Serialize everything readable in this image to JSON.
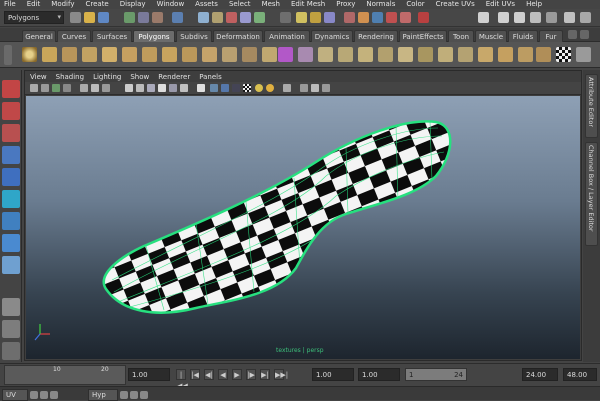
{
  "menubar": {
    "items": [
      "File",
      "Edit",
      "Modify",
      "Create",
      "Display",
      "Window",
      "Assets",
      "Select",
      "Mesh",
      "Edit Mesh",
      "Proxy",
      "Normals",
      "Color",
      "Create UVs",
      "Edit UVs",
      "Help"
    ]
  },
  "statusline": {
    "mode": "Polygons",
    "mode_arrow": "▾"
  },
  "shelf": {
    "tabs": [
      "General",
      "Curves",
      "Surfaces",
      "Polygons",
      "Subdivs",
      "Deformation",
      "Animation",
      "Dynamics",
      "Rendering",
      "PaintEffects",
      "Toon",
      "Muscle",
      "Fluids",
      "Fur"
    ],
    "active_tab": "Polygons"
  },
  "panel": {
    "menu": [
      "View",
      "Shading",
      "Lighting",
      "Show",
      "Renderer",
      "Panels"
    ],
    "camera_label": "textures | persp"
  },
  "side_tabs": {
    "attribute_editor": "Attribute Editor",
    "channel_box": "Channel Box / Layer Editor"
  },
  "timeslider": {
    "ticks": [
      "10",
      "20"
    ],
    "current_time": "1.00",
    "start_time": "1.00",
    "start_range": "1.00",
    "range_start_label": "1",
    "range_end_label": "24",
    "end_range": "24.00",
    "end_time": "48.00",
    "buttons": [
      "|◀◀",
      "|◀",
      "◀|",
      "◀",
      "▶",
      "|▶",
      "▶|",
      "▶▶|"
    ]
  },
  "taskbar": {
    "items": [
      "UV",
      "Hyp"
    ]
  },
  "colors": {
    "wireframe_highlight": "#27e07f",
    "checker_dark": "#0c0c0c",
    "checker_light": "#f4f4f4",
    "shelf_active_tab": "#6c6c6c"
  }
}
